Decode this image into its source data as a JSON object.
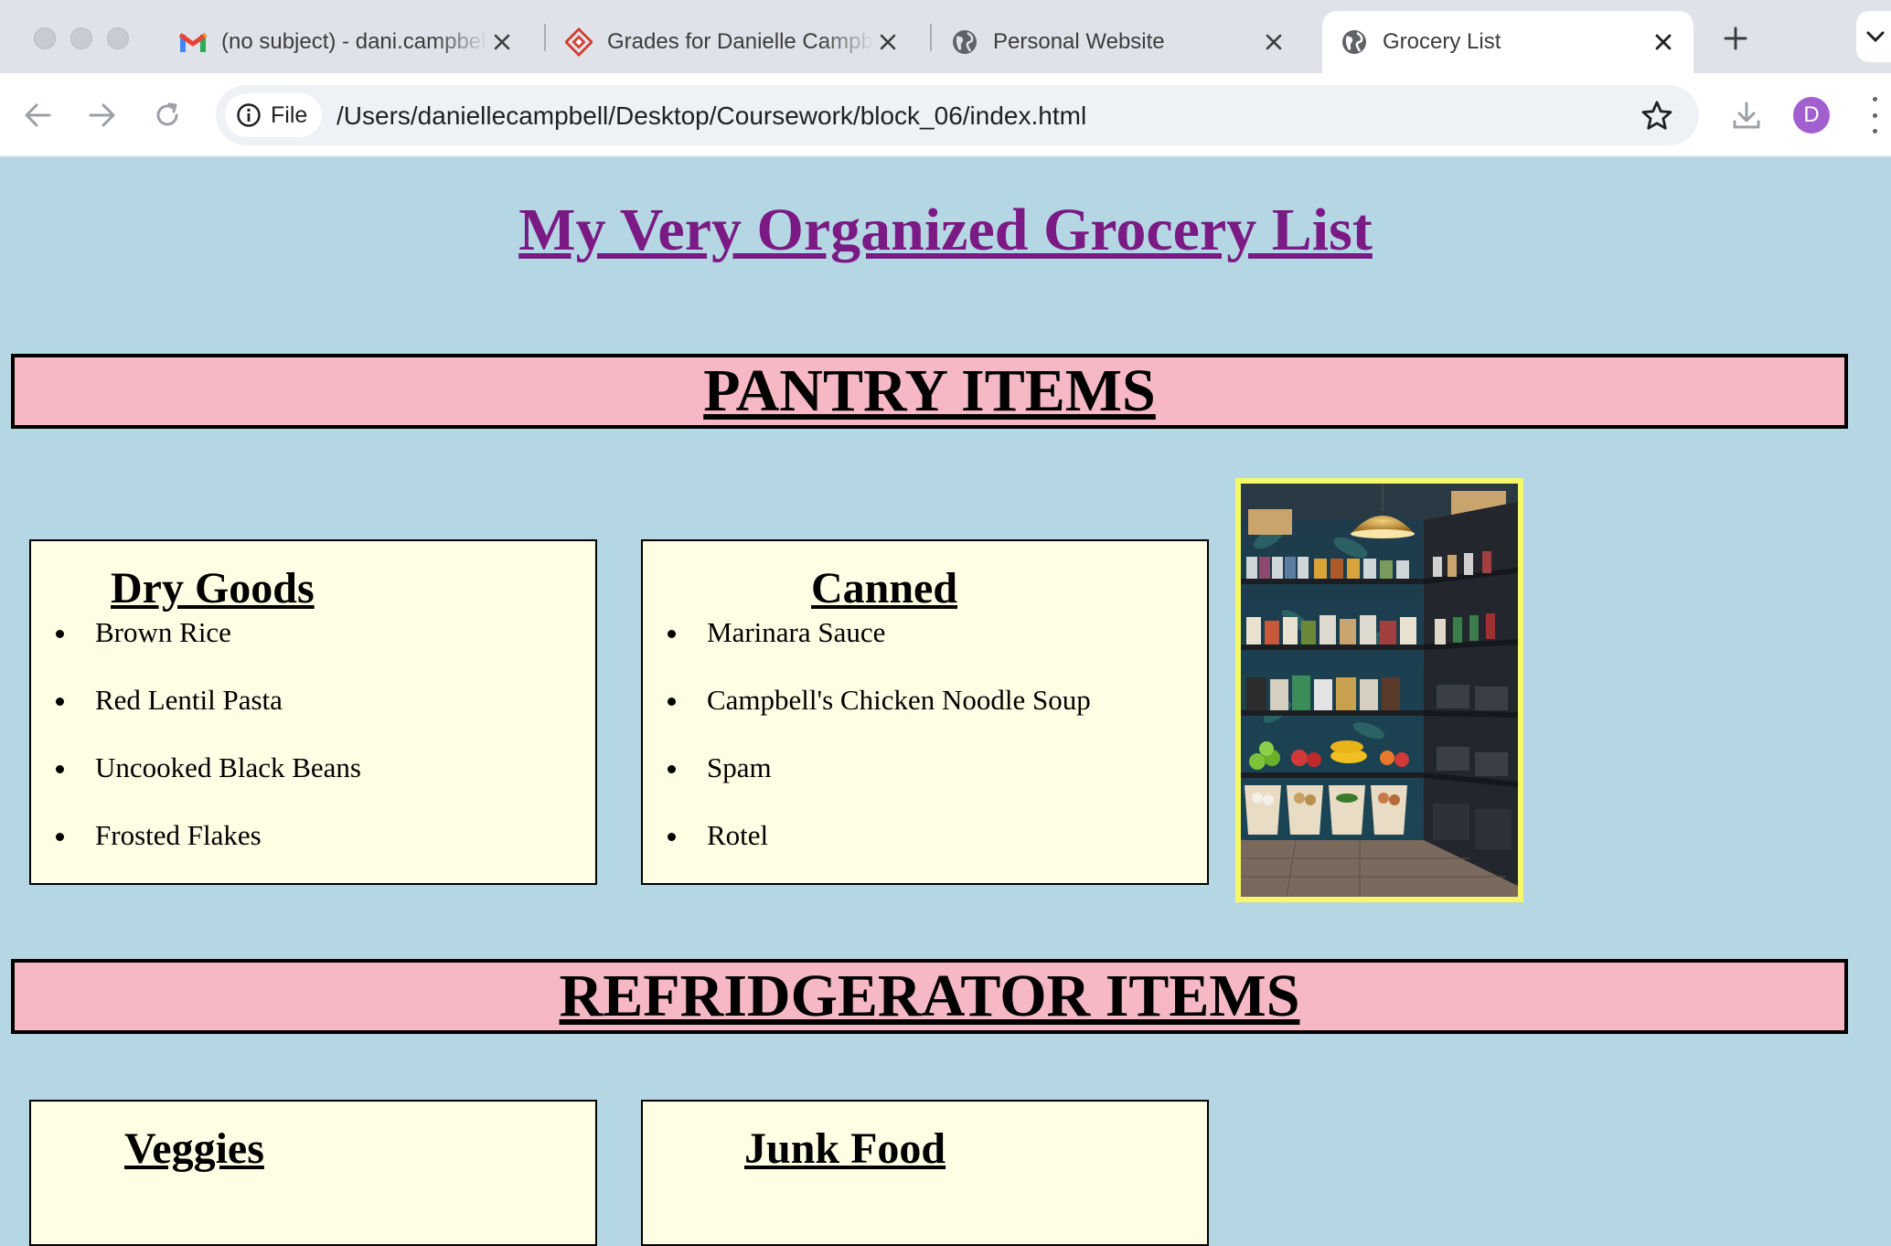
{
  "browser": {
    "tabs": [
      {
        "title": "(no subject) - dani.campbell",
        "icon": "gmail-icon"
      },
      {
        "title": "Grades for Danielle Campbell",
        "icon": "canvas-icon"
      },
      {
        "title": "Personal Website",
        "icon": "globe-icon"
      },
      {
        "title": "Grocery List",
        "icon": "globe-icon",
        "active": true
      }
    ],
    "site_info_label": "File",
    "url": "/Users/daniellecampbell/Desktop/Coursework/block_06/index.html",
    "profile_initial": "D"
  },
  "page": {
    "title": "My Very Organized Grocery List",
    "sections": [
      {
        "heading": "PANTRY ITEMS",
        "lists": [
          {
            "heading": "Dry Goods",
            "items": [
              "Brown Rice",
              "Red Lentil Pasta",
              "Uncooked Black Beans",
              "Frosted Flakes"
            ]
          },
          {
            "heading": "Canned",
            "items": [
              "Marinara Sauce",
              "Campbell's Chicken Noodle Soup",
              "Spam",
              "Rotel"
            ]
          }
        ],
        "image": "pantry-photo"
      },
      {
        "heading": "REFRIDGERATOR ITEMS",
        "lists": [
          {
            "heading": "Veggies",
            "items": []
          },
          {
            "heading": "Junk Food",
            "items": []
          }
        ]
      }
    ]
  },
  "colors": {
    "page_background": "#b5d7e3",
    "title": "#7b1a85",
    "banner": "#f5b8c4",
    "card": "#fffde3",
    "image_border": "#f6f86a"
  }
}
